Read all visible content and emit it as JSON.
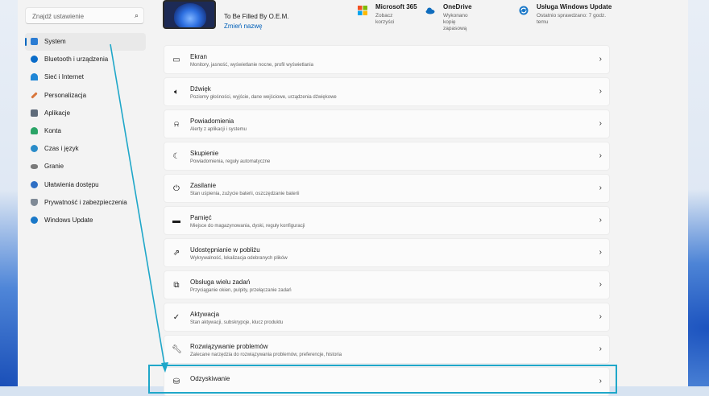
{
  "search": {
    "placeholder": "Znajdź ustawienie",
    "icon": "search-icon"
  },
  "sidebar": {
    "items": [
      {
        "label": "System",
        "icon": "monitor-icon",
        "color": "#2b7cd3",
        "active": true
      },
      {
        "label": "Bluetooth i urządzenia",
        "icon": "bluetooth-icon",
        "color": "#0a6cc9"
      },
      {
        "label": "Sieć i Internet",
        "icon": "wifi-icon",
        "color": "#1f86d6"
      },
      {
        "label": "Personalizacja",
        "icon": "brush-icon",
        "color": "#d9763b"
      },
      {
        "label": "Aplikacje",
        "icon": "apps-icon",
        "color": "#5f6b7a"
      },
      {
        "label": "Konta",
        "icon": "user-icon",
        "color": "#2aa467"
      },
      {
        "label": "Czas i język",
        "icon": "globe-clock-icon",
        "color": "#2a8cc9"
      },
      {
        "label": "Granie",
        "icon": "gamepad-icon",
        "color": "#7a7a7a"
      },
      {
        "label": "Ułatwienia dostępu",
        "icon": "accessibility-icon",
        "color": "#2f6fc4"
      },
      {
        "label": "Prywatność i zabezpieczenia",
        "icon": "shield-icon",
        "color": "#7f8a96"
      },
      {
        "label": "Windows Update",
        "icon": "refresh-icon",
        "color": "#1a78c8"
      }
    ]
  },
  "header": {
    "device_name": "To Be Filled By O.E.M.",
    "rename_label": "Zmień nazwę",
    "items": [
      {
        "title": "Microsoft 365",
        "subtitle": "Zobacz korzyści",
        "icon": "microsoft-logo-icon"
      },
      {
        "title": "OneDrive",
        "subtitle": "Wykonano kopię zapasową",
        "icon": "cloud-icon"
      },
      {
        "title": "Usługa Windows Update",
        "subtitle": "Ostatnio sprawdzano: 7 godz. temu",
        "icon": "update-icon"
      }
    ]
  },
  "cards": [
    {
      "title": "Ekran",
      "subtitle": "Monitory, jasność, wyświetlanie nocne, profil wyświetlania",
      "icon": "display-icon"
    },
    {
      "title": "Dźwięk",
      "subtitle": "Poziomy głośności, wyjście, dane wejściowe, urządzenia dźwiękowe",
      "icon": "speaker-icon"
    },
    {
      "title": "Powiadomienia",
      "subtitle": "Alerty z aplikacji i systemu",
      "icon": "bell-icon"
    },
    {
      "title": "Skupienie",
      "subtitle": "Powiadomienia, reguły automatyczne",
      "icon": "moon-icon"
    },
    {
      "title": "Zasilanie",
      "subtitle": "Stan uśpienia, zużycie baterii, oszczędzanie baterii",
      "icon": "power-icon"
    },
    {
      "title": "Pamięć",
      "subtitle": "Miejsce do magazynowania, dyski, reguły konfiguracji",
      "icon": "storage-icon"
    },
    {
      "title": "Udostępnianie w pobliżu",
      "subtitle": "Wykrywalność, lokalizacja odebranych plików",
      "icon": "share-icon"
    },
    {
      "title": "Obsługa wielu zadań",
      "subtitle": "Przyciąganie okien, pulpity, przełączanie zadań",
      "icon": "multitask-icon"
    },
    {
      "title": "Aktywacja",
      "subtitle": "Stan aktywacji, subskrypcje, klucz produktu",
      "icon": "check-circle-icon"
    },
    {
      "title": "Rozwiązywanie problemów",
      "subtitle": "Zalecane narzędzia do rozwiązywania problemów, preferencje, historia",
      "icon": "wrench-icon"
    },
    {
      "title": "Odzyskiwanie",
      "subtitle": "",
      "icon": "recovery-icon"
    }
  ],
  "colors": {
    "accent": "#0067c0",
    "annotation": "#1fa7c9"
  }
}
